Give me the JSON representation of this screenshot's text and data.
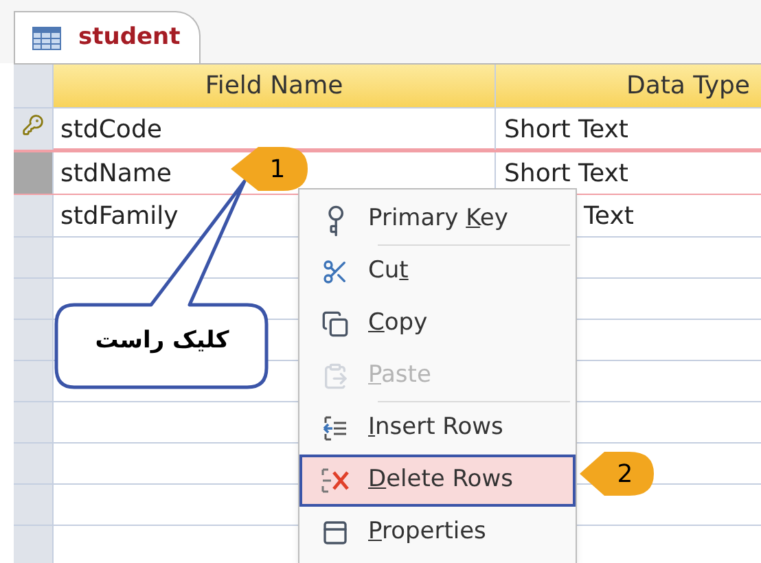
{
  "tab": {
    "title": "student",
    "selected": true
  },
  "table": {
    "columns": [
      "Field Name",
      "Data Type"
    ],
    "rows": [
      {
        "field_name": "stdCode",
        "data_type": "Short Text",
        "primary_key": true,
        "selected": false,
        "data_type_covered": false
      },
      {
        "field_name": "stdName",
        "data_type": "Short Text",
        "primary_key": false,
        "selected": true,
        "data_type_covered": false
      },
      {
        "field_name": "stdFamily",
        "data_type": "Text",
        "primary_key": false,
        "selected": false,
        "data_type_covered": true
      }
    ]
  },
  "context_menu": {
    "items": [
      {
        "kind": "primary_key",
        "label_parts": {
          "before": "Primary ",
          "key": "K",
          "after": "ey"
        },
        "disabled": false,
        "selected": false,
        "separator_after": true
      },
      {
        "kind": "cut",
        "label_parts": {
          "before": "Cu",
          "key": "t"
        },
        "disabled": false,
        "selected": false,
        "separator_after": false
      },
      {
        "kind": "copy",
        "label_parts": {
          "key": "C",
          "after": "opy"
        },
        "disabled": false,
        "selected": false,
        "separator_after": false
      },
      {
        "kind": "paste",
        "label_parts": {
          "key": "P",
          "after": "aste"
        },
        "disabled": true,
        "selected": false,
        "separator_after": true
      },
      {
        "kind": "insert_rows",
        "label_parts": {
          "key": "I",
          "after": "nsert Rows"
        },
        "disabled": false,
        "selected": false,
        "separator_after": false
      },
      {
        "kind": "delete_rows",
        "label_parts": {
          "key": "D",
          "after": "elete Rows"
        },
        "disabled": false,
        "selected": true,
        "separator_after": false
      },
      {
        "kind": "properties",
        "label_parts": {
          "key": "P",
          "after": "roperties"
        },
        "disabled": false,
        "selected": false,
        "separator_after": false
      }
    ]
  },
  "callouts": {
    "step_1": "1",
    "step_2": "2",
    "note": "کلیک راست"
  }
}
